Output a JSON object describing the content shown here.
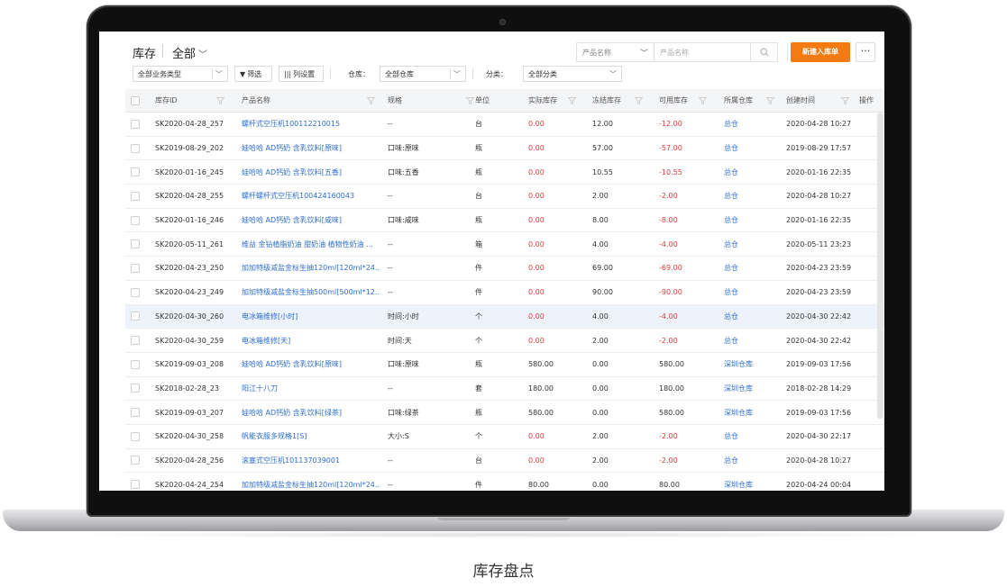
{
  "caption": "库存盘点",
  "header": {
    "title": "库存",
    "scope": "全部",
    "search_type": "产品名称",
    "search_placeholder": "产品名称",
    "new_button": "新建入库单",
    "more_button": "···"
  },
  "toolbar": {
    "business_type": "全部业务类型",
    "filter_button": "筛选",
    "columns_button": "列设置",
    "warehouse_label": "仓库：",
    "warehouse_value": "全部仓库",
    "category_label": "分类：",
    "category_value": "全部分类"
  },
  "columns": [
    "库存ID",
    "产品名称",
    "规格",
    "单位",
    "实际库存",
    "冻结库存",
    "可用库存",
    "所属仓库",
    "创建时间",
    "操作"
  ],
  "rows": [
    {
      "id": "SK2020-04-28_257",
      "name": "螺杆式空压机100112210015",
      "spec": "--",
      "unit": "台",
      "actual": "0.00",
      "frozen": "12.00",
      "available": "-12.00",
      "warehouse": "总仓",
      "created": "2020-04-28 10:27",
      "actual_red": true,
      "avail_red": true
    },
    {
      "id": "SK2019-08-29_202",
      "name": "娃哈哈 AD钙奶 含乳饮料[原味]",
      "spec": "口味:原味",
      "unit": "瓶",
      "actual": "0.00",
      "frozen": "57.00",
      "available": "-57.00",
      "warehouse": "总仓",
      "created": "2019-08-29 17:57",
      "actual_red": true,
      "avail_red": true
    },
    {
      "id": "SK2020-01-16_245",
      "name": "娃哈哈 AD钙奶 含乳饮料[五香]",
      "spec": "口味:五香",
      "unit": "瓶",
      "actual": "0.00",
      "frozen": "10.55",
      "available": "-10.55",
      "warehouse": "总仓",
      "created": "2020-01-16 22:35",
      "actual_red": true,
      "avail_red": true
    },
    {
      "id": "SK2020-04-28_255",
      "name": "螺杆螺杆式空压机100424160043",
      "spec": "--",
      "unit": "台",
      "actual": "0.00",
      "frozen": "2.00",
      "available": "-2.00",
      "warehouse": "总仓",
      "created": "2020-04-28 10:27",
      "actual_red": true,
      "avail_red": true
    },
    {
      "id": "SK2020-01-16_246",
      "name": "娃哈哈 AD钙奶 含乳饮料[咸味]",
      "spec": "口味:咸味",
      "unit": "瓶",
      "actual": "0.00",
      "frozen": "8.00",
      "available": "-8.00",
      "warehouse": "总仓",
      "created": "2020-01-16 22:35",
      "actual_red": true,
      "avail_red": true
    },
    {
      "id": "SK2020-05-11_261",
      "name": "维益 金钻植脂奶油 甜奶油 植物性奶油 ...",
      "spec": "--",
      "unit": "箱",
      "actual": "0.00",
      "frozen": "4.00",
      "available": "-4.00",
      "warehouse": "总仓",
      "created": "2020-05-11 23:23",
      "actual_red": true,
      "avail_red": true
    },
    {
      "id": "SK2020-04-23_250",
      "name": "加加特级减盐金标生抽120ml[120ml*24...",
      "spec": "--",
      "unit": "件",
      "actual": "0.00",
      "frozen": "69.00",
      "available": "-69.00",
      "warehouse": "总仓",
      "created": "2020-04-23 23:59",
      "actual_red": true,
      "avail_red": true
    },
    {
      "id": "SK2020-04-23_249",
      "name": "加加特级减盐金标生抽500ml[500ml*12...",
      "spec": "--",
      "unit": "件",
      "actual": "0.00",
      "frozen": "90.00",
      "available": "-90.00",
      "warehouse": "总仓",
      "created": "2020-04-23 23:59",
      "actual_red": true,
      "avail_red": true
    },
    {
      "id": "SK2020-04-30_260",
      "name": "电冰箱维修[小时]",
      "spec": "时间:小时",
      "unit": "个",
      "actual": "0.00",
      "frozen": "4.00",
      "available": "-4.00",
      "warehouse": "总仓",
      "created": "2020-04-30 22:42",
      "actual_red": true,
      "avail_red": true,
      "highlight": true
    },
    {
      "id": "SK2020-04-30_259",
      "name": "电冰箱维修[天]",
      "spec": "时间:天",
      "unit": "个",
      "actual": "0.00",
      "frozen": "2.00",
      "available": "-2.00",
      "warehouse": "总仓",
      "created": "2020-04-30 22:42",
      "actual_red": true,
      "avail_red": true
    },
    {
      "id": "SK2019-09-03_208",
      "name": "娃哈哈 AD钙奶 含乳饮料[原味]",
      "spec": "口味:原味",
      "unit": "瓶",
      "actual": "580.00",
      "frozen": "0.00",
      "available": "580.00",
      "warehouse": "深圳仓库",
      "created": "2019-09-03 17:56",
      "actual_red": false,
      "avail_red": false
    },
    {
      "id": "SK2018-02-28_23",
      "name": "阳江十八刀",
      "spec": "--",
      "unit": "套",
      "actual": "180.00",
      "frozen": "0.00",
      "available": "180.00",
      "warehouse": "深圳仓库",
      "created": "2018-02-28 14:29",
      "actual_red": false,
      "avail_red": false
    },
    {
      "id": "SK2019-09-03_207",
      "name": "娃哈哈 AD钙奶 含乳饮料[绿茶]",
      "spec": "口味:绿茶",
      "unit": "瓶",
      "actual": "580.00",
      "frozen": "0.00",
      "available": "580.00",
      "warehouse": "深圳仓库",
      "created": "2019-09-03 17:56",
      "actual_red": false,
      "avail_red": false
    },
    {
      "id": "SK2020-04-30_258",
      "name": "帆能衣服多规格1[S]",
      "spec": "大小:S",
      "unit": "个",
      "actual": "0.00",
      "frozen": "2.00",
      "available": "-2.00",
      "warehouse": "总仓",
      "created": "2020-04-30 22:17",
      "actual_red": true,
      "avail_red": true
    },
    {
      "id": "SK2020-04-28_256",
      "name": "滚塞式空压机101137039001",
      "spec": "--",
      "unit": "台",
      "actual": "0.00",
      "frozen": "2.00",
      "available": "-2.00",
      "warehouse": "总仓",
      "created": "2020-04-28 10:27",
      "actual_red": true,
      "avail_red": true
    },
    {
      "id": "SK2020-04-24_254",
      "name": "加加特级减盐金标生抽120ml[120ml*24...",
      "spec": "--",
      "unit": "件",
      "actual": "80.00",
      "frozen": "0.00",
      "available": "80.00",
      "warehouse": "深圳仓库",
      "created": "2020-04-24 00:04",
      "actual_red": false,
      "avail_red": false
    }
  ]
}
